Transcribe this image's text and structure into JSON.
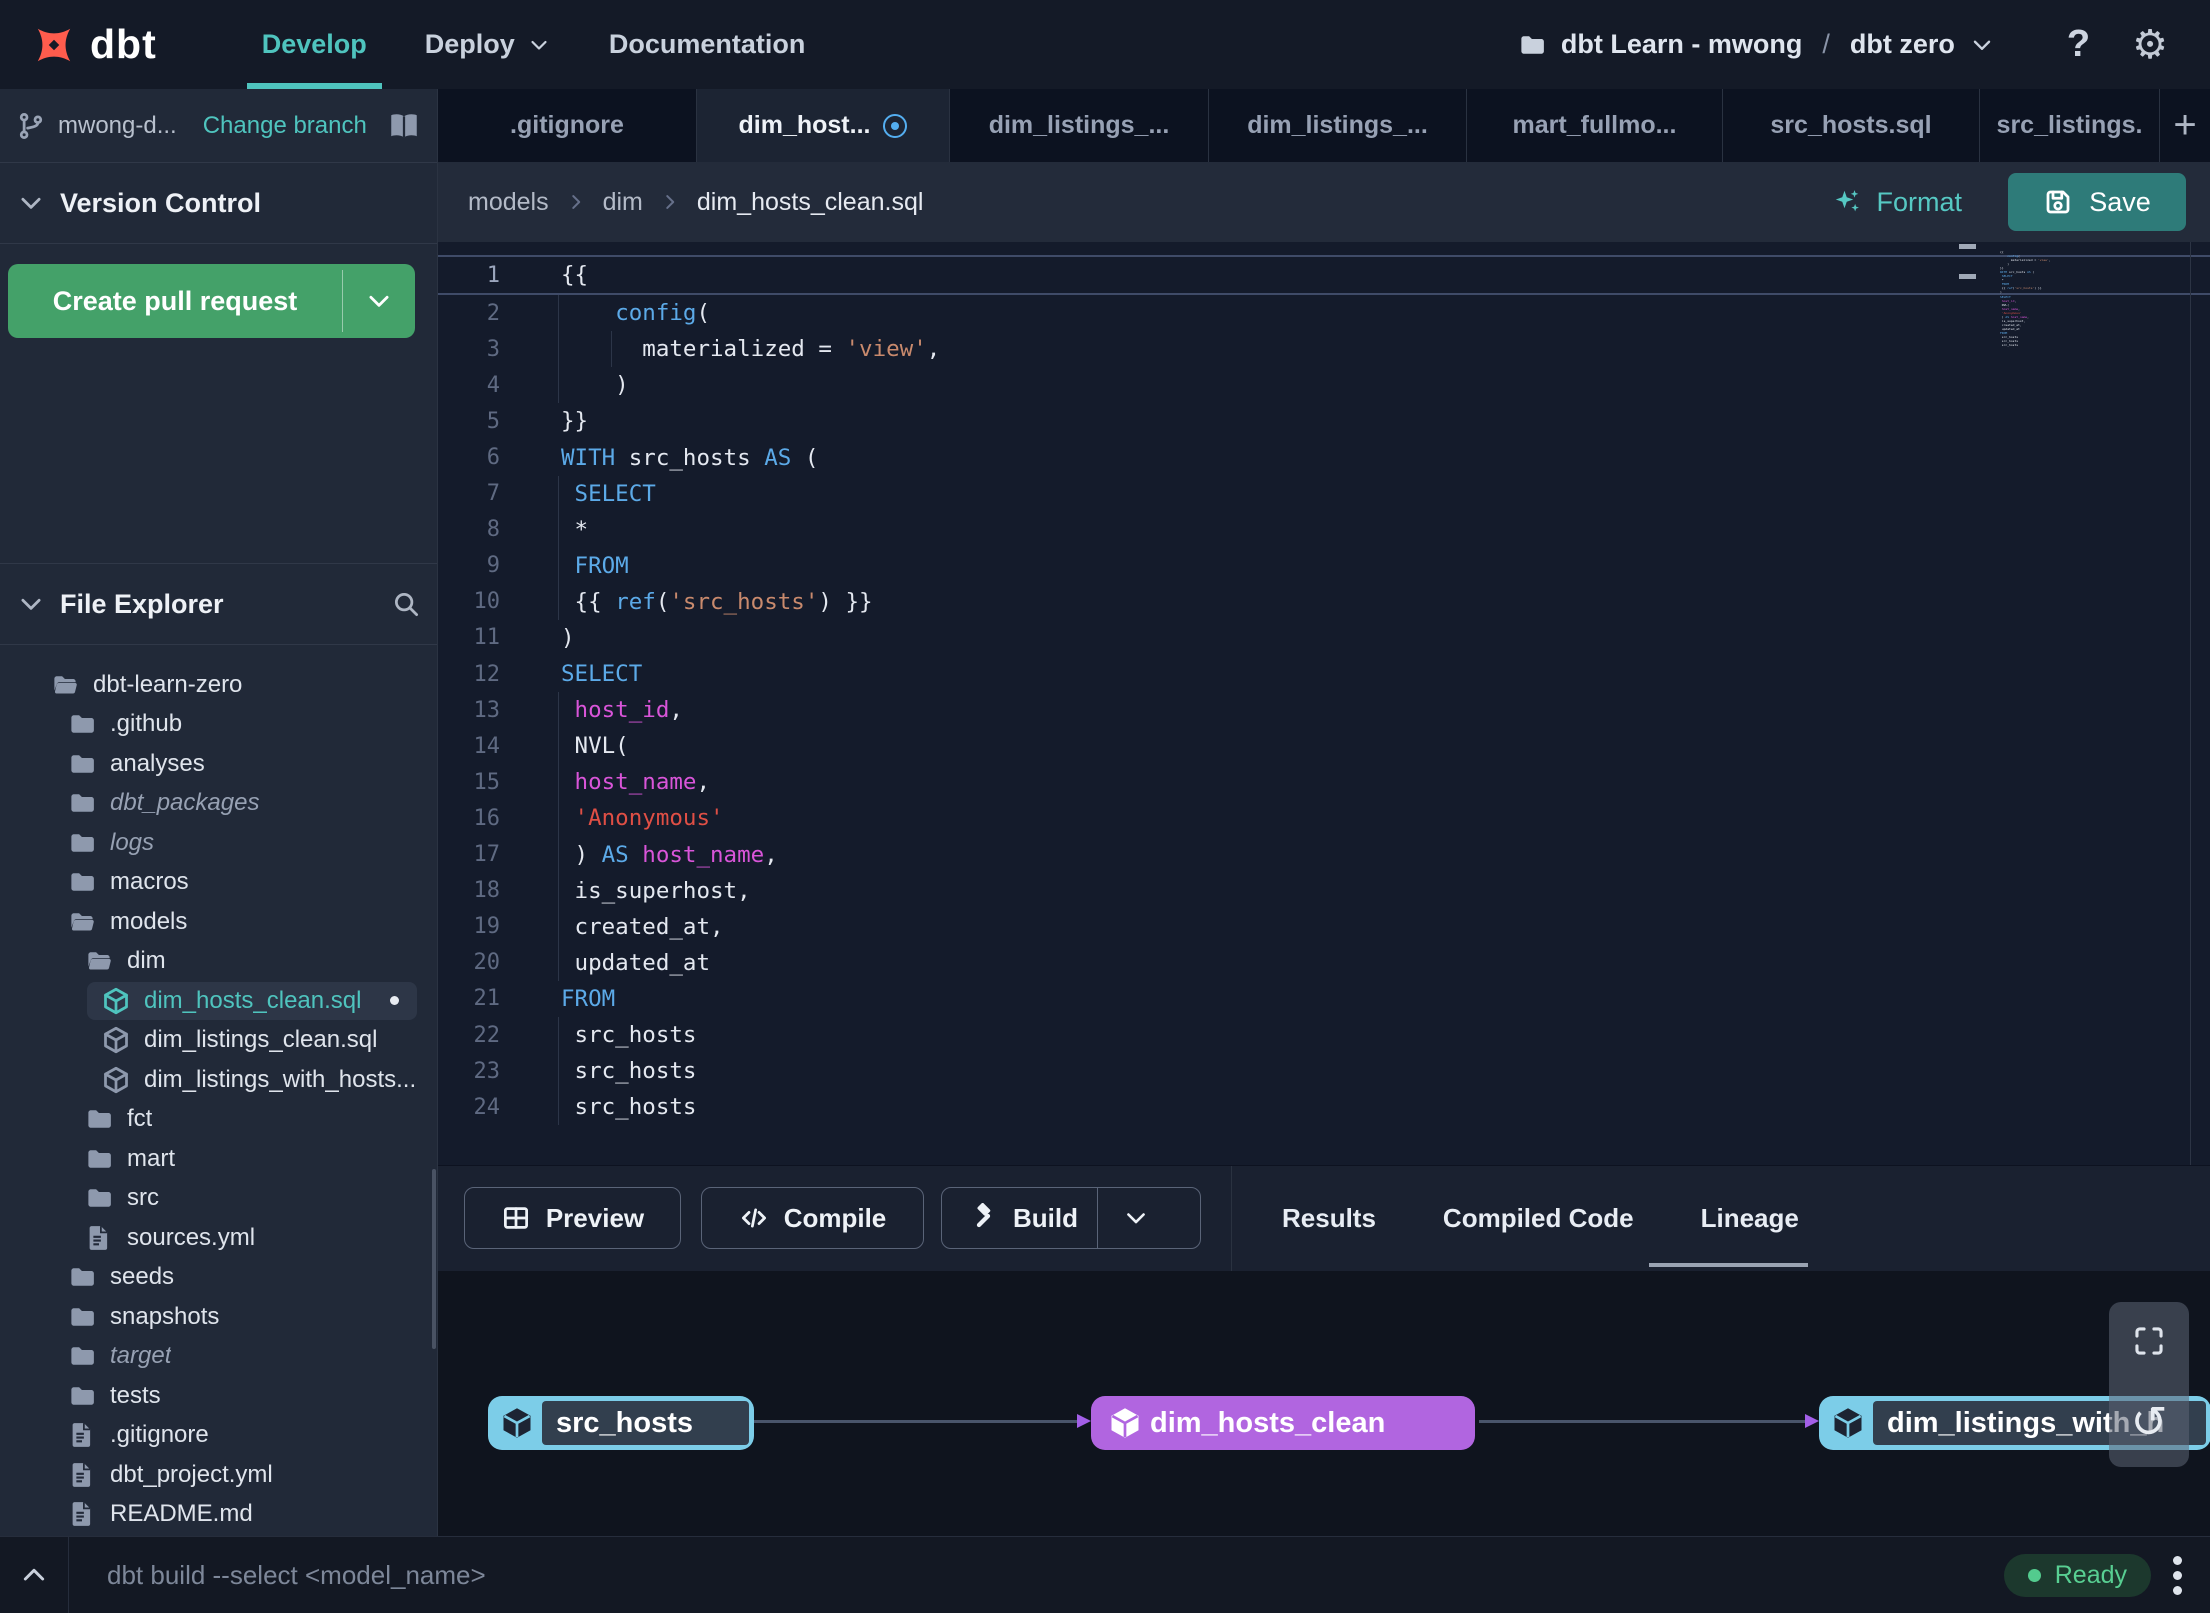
{
  "colors": {
    "accent_teal": "#4fc4be",
    "pr_green": "#44a169",
    "save_teal": "#2e7b79",
    "node_blue": "#7ccde8",
    "node_purple": "#b165e0",
    "ready_green": "#58cf92",
    "modified_blue": "#54aef0",
    "code_keyword": "#5caae8",
    "code_string": "#c98a6d",
    "code_string_red": "#e04f45",
    "code_field": "#d955d9"
  },
  "navbar": {
    "logo": "dbt",
    "items": [
      {
        "label": "Develop",
        "active": true,
        "caret": false
      },
      {
        "label": "Deploy",
        "active": false,
        "caret": true
      },
      {
        "label": "Documentation",
        "active": false,
        "caret": false
      }
    ],
    "project_name": "dbt Learn - mwong",
    "separator": "/",
    "environment": "dbt zero",
    "help": "?"
  },
  "tab_bar": {
    "tabs": [
      {
        "label": ".gitignore"
      },
      {
        "label": "dim_host...",
        "active": true,
        "modified": true
      },
      {
        "label": "dim_listings_..."
      },
      {
        "label": "dim_listings_..."
      },
      {
        "label": "mart_fullmo..."
      },
      {
        "label": "src_hosts.sql"
      },
      {
        "label": "src_listings."
      }
    ],
    "add_button": "+"
  },
  "breadcrumb": {
    "parts": [
      "models",
      "dim",
      "dim_hosts_clean.sql"
    ]
  },
  "editor_actions": {
    "format": "Format",
    "save": "Save"
  },
  "sidebar": {
    "branch": {
      "name": "mwong-d...",
      "change_link": "Change branch"
    },
    "version_control_header": "Version Control",
    "create_pr_button": "Create pull request",
    "file_explorer_header": "File Explorer",
    "tree": [
      {
        "label": "dbt-learn-zero",
        "type": "folder-open",
        "depth": 0
      },
      {
        "label": ".github",
        "type": "folder",
        "depth": 1
      },
      {
        "label": "analyses",
        "type": "folder",
        "depth": 1
      },
      {
        "label": "dbt_packages",
        "type": "folder",
        "depth": 1,
        "italic": true
      },
      {
        "label": "logs",
        "type": "folder",
        "depth": 1,
        "italic": true
      },
      {
        "label": "macros",
        "type": "folder",
        "depth": 1
      },
      {
        "label": "models",
        "type": "folder-open",
        "depth": 1
      },
      {
        "label": "dim",
        "type": "folder-open",
        "depth": 2
      },
      {
        "label": "dim_hosts_clean.sql",
        "type": "model",
        "depth": 3,
        "selected": true,
        "modified": true
      },
      {
        "label": "dim_listings_clean.sql",
        "type": "model",
        "depth": 3
      },
      {
        "label": "dim_listings_with_hosts...",
        "type": "model",
        "depth": 3
      },
      {
        "label": "fct",
        "type": "folder",
        "depth": 2
      },
      {
        "label": "mart",
        "type": "folder",
        "depth": 2
      },
      {
        "label": "src",
        "type": "folder",
        "depth": 2
      },
      {
        "label": "sources.yml",
        "type": "file",
        "depth": 2
      },
      {
        "label": "seeds",
        "type": "folder",
        "depth": 1
      },
      {
        "label": "snapshots",
        "type": "folder",
        "depth": 1
      },
      {
        "label": "target",
        "type": "folder",
        "depth": 1,
        "italic": true
      },
      {
        "label": "tests",
        "type": "folder",
        "depth": 1
      },
      {
        "label": ".gitignore",
        "type": "file",
        "depth": 1
      },
      {
        "label": "dbt_project.yml",
        "type": "file",
        "depth": 1
      },
      {
        "label": "README.md",
        "type": "file",
        "depth": 1
      }
    ]
  },
  "editor": {
    "lines": [
      {
        "num": 1,
        "tokens": [
          [
            "{{",
            "d"
          ]
        ],
        "current": true
      },
      {
        "num": 2,
        "tokens": [
          [
            "    ",
            "d"
          ],
          [
            "config",
            "k"
          ],
          [
            "(",
            "d"
          ]
        ],
        "guides": [
          0
        ]
      },
      {
        "num": 3,
        "tokens": [
          [
            "      materialized = ",
            "d"
          ],
          [
            "'view'",
            "s"
          ],
          [
            ",",
            "d"
          ]
        ],
        "guides": [
          0,
          53
        ]
      },
      {
        "num": 4,
        "tokens": [
          [
            "    )",
            "d"
          ]
        ],
        "guides": [
          0
        ]
      },
      {
        "num": 5,
        "tokens": [
          [
            "}}",
            "d"
          ]
        ]
      },
      {
        "num": 6,
        "tokens": [
          [
            "WITH",
            "k"
          ],
          [
            " src_hosts ",
            "d"
          ],
          [
            "AS",
            "k"
          ],
          [
            " (",
            "d"
          ]
        ]
      },
      {
        "num": 7,
        "tokens": [
          [
            " ",
            "d"
          ],
          [
            "SELECT",
            "k"
          ]
        ],
        "guides": [
          0
        ]
      },
      {
        "num": 8,
        "tokens": [
          [
            " *",
            "d"
          ]
        ],
        "guides": [
          0
        ]
      },
      {
        "num": 9,
        "tokens": [
          [
            " ",
            "d"
          ],
          [
            "FROM",
            "k"
          ]
        ],
        "guides": [
          0
        ]
      },
      {
        "num": 10,
        "tokens": [
          [
            " {{ ",
            "d"
          ],
          [
            "ref",
            "k"
          ],
          [
            "(",
            "d"
          ],
          [
            "'src_hosts'",
            "s"
          ],
          [
            ") }}",
            "d"
          ]
        ],
        "guides": [
          0
        ]
      },
      {
        "num": 11,
        "tokens": [
          [
            ")",
            "d"
          ]
        ]
      },
      {
        "num": 12,
        "tokens": [
          [
            "SELECT",
            "k"
          ]
        ]
      },
      {
        "num": 13,
        "tokens": [
          [
            " ",
            "d"
          ],
          [
            "host_id",
            "m"
          ],
          [
            ",",
            "d"
          ]
        ],
        "guides": [
          0
        ]
      },
      {
        "num": 14,
        "tokens": [
          [
            " NVL(",
            "d"
          ]
        ],
        "guides": [
          0
        ]
      },
      {
        "num": 15,
        "tokens": [
          [
            " ",
            "d"
          ],
          [
            "host_name",
            "m"
          ],
          [
            ",",
            "d"
          ]
        ],
        "guides": [
          0
        ]
      },
      {
        "num": 16,
        "tokens": [
          [
            " ",
            "d"
          ],
          [
            "'Anonymous'",
            "r"
          ]
        ],
        "guides": [
          0
        ]
      },
      {
        "num": 17,
        "tokens": [
          [
            " ) ",
            "d"
          ],
          [
            "AS",
            "k"
          ],
          [
            " ",
            "d"
          ],
          [
            "host_name",
            "m"
          ],
          [
            ",",
            "d"
          ]
        ],
        "guides": [
          0
        ]
      },
      {
        "num": 18,
        "tokens": [
          [
            " is_superhost,",
            "d"
          ]
        ],
        "guides": [
          0
        ]
      },
      {
        "num": 19,
        "tokens": [
          [
            " created_at,",
            "d"
          ]
        ],
        "guides": [
          0
        ]
      },
      {
        "num": 20,
        "tokens": [
          [
            " updated_at",
            "d"
          ]
        ],
        "guides": [
          0
        ]
      },
      {
        "num": 21,
        "tokens": [
          [
            "FROM",
            "k"
          ]
        ]
      },
      {
        "num": 22,
        "tokens": [
          [
            " src_hosts",
            "d"
          ]
        ],
        "guides": [
          0
        ]
      },
      {
        "num": 23,
        "tokens": [
          [
            " src_hosts",
            "d"
          ]
        ],
        "guides": [
          0
        ]
      },
      {
        "num": 24,
        "tokens": [
          [
            " src_hosts",
            "d"
          ]
        ],
        "guides": [
          0
        ]
      }
    ]
  },
  "bottom_panel": {
    "buttons": [
      {
        "label": "Preview",
        "icon": "grid"
      },
      {
        "label": "Compile",
        "icon": "code"
      },
      {
        "label": "Build",
        "icon": "hammer",
        "dropdown": true
      }
    ],
    "tabs": [
      {
        "label": "Results"
      },
      {
        "label": "Compiled Code"
      },
      {
        "label": "Lineage",
        "active": true
      }
    ]
  },
  "lineage": {
    "nodes": [
      {
        "label": "src_hosts",
        "style": "source"
      },
      {
        "label": "dim_hosts_clean",
        "style": "current"
      },
      {
        "label": "dim_listings_with_h",
        "style": "source"
      }
    ]
  },
  "status_bar": {
    "command": "dbt build --select <model_name>",
    "status": "Ready"
  }
}
